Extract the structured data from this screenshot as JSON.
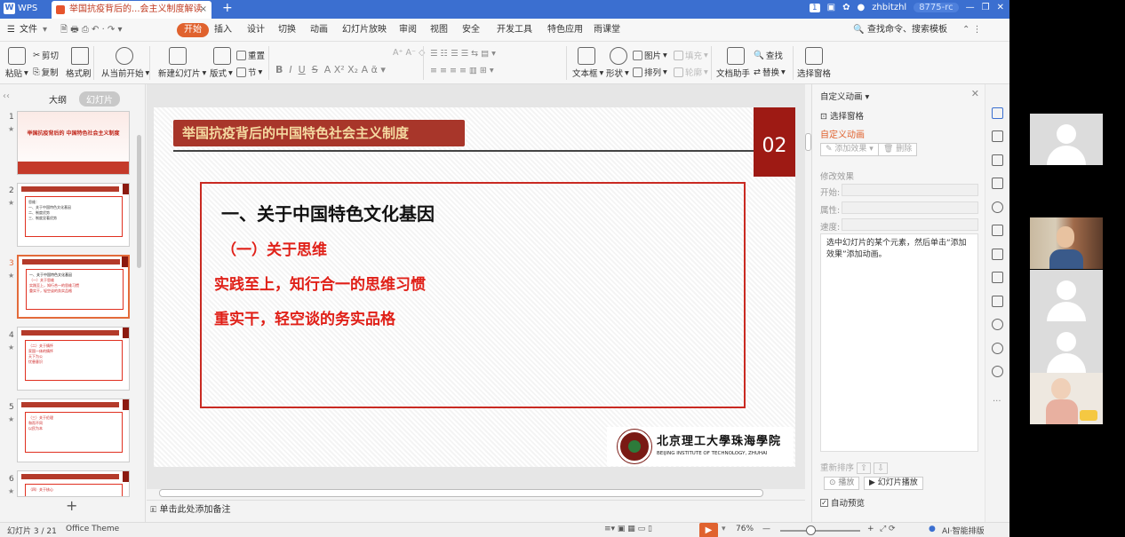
{
  "titlebar": {
    "app": "WPS",
    "doc_tab": "举国抗疫背后的...会主义制度解读",
    "user": "zhbitzhl",
    "user_id": "8775-rc",
    "badge": "1"
  },
  "menu": {
    "file": "文件",
    "items": [
      "开始",
      "插入",
      "设计",
      "切换",
      "动画",
      "幻灯片放映",
      "审阅",
      "视图",
      "安全",
      "开发工具",
      "特色应用",
      "雨课堂"
    ],
    "search": "查找命令、搜索模板"
  },
  "ribbon": {
    "paste": "粘贴",
    "cut": "剪切",
    "copy": "复制",
    "format_painter": "格式刷",
    "from_current": "从当前开始",
    "new_slide": "新建幻灯片",
    "layout": "版式",
    "section": "节",
    "reset": "重置",
    "textbox": "文本框",
    "shape": "形状",
    "picture": "图片",
    "arrange": "排列",
    "fill": "填充",
    "outline": "轮廓",
    "doc_helper": "文档助手",
    "find": "查找",
    "replace": "替换",
    "select_pane": "选择窗格"
  },
  "leftpane": {
    "tab_outline": "大纲",
    "tab_slides": "幻灯片",
    "thumbs": [
      {
        "num": "1",
        "title": "举国抗疫背后的 中国特色社会主义制度"
      },
      {
        "num": "2",
        "lines": [
          "思维：",
          "一、关于中国特色文化基因",
          "二、制度优势",
          "三、制度显著优势"
        ]
      },
      {
        "num": "3",
        "lines": [
          "一、关于中国特色文化基因",
          "（一）关于思维",
          "实践至上，知行合一的思维习惯",
          "重实干，轻空谈的务实品格"
        ]
      },
      {
        "num": "4",
        "lines": [
          "（二）关于情怀",
          "家国一体的情怀",
          "天下为公",
          "忧患意识"
        ]
      },
      {
        "num": "5",
        "lines": [
          "（三）关于伦理",
          "和而不同",
          "以民为本"
        ]
      },
      {
        "num": "6",
        "lines": [
          "（四）关于核心"
        ]
      }
    ]
  },
  "slide": {
    "title": "举国抗疫背后的中国特色社会主义制度",
    "number": "02",
    "heading": "一、关于中国特色文化基因",
    "subheading": "（一）关于思维",
    "lines": [
      "实践至上，知行合一的思维习惯",
      "重实干，轻空谈的务实品格"
    ],
    "school_cn": "北京理工大學珠海學院",
    "school_en": "BEIJING INSTITUTE OF TECHNOLOGY, ZHUHAI"
  },
  "notes": "单击此处添加备注",
  "rightpane": {
    "header": "自定义动画",
    "select_pane": "选择窗格",
    "section": "自定义动画",
    "add_effect": "添加效果",
    "delete": "删除",
    "modify": "修改效果",
    "start": "开始:",
    "property": "属性:",
    "speed": "速度:",
    "info": "选中幻灯片的某个元素，然后单击“添加效果”添加动画。",
    "reorder": "重新排序",
    "play": "播放",
    "slideshow": "幻灯片播放",
    "autopreview": "自动预览"
  },
  "statusbar": {
    "slide_info": "幻灯片 3 / 21",
    "theme": "Office Theme",
    "zoom": "76%",
    "ai": "AI·智能排版"
  }
}
